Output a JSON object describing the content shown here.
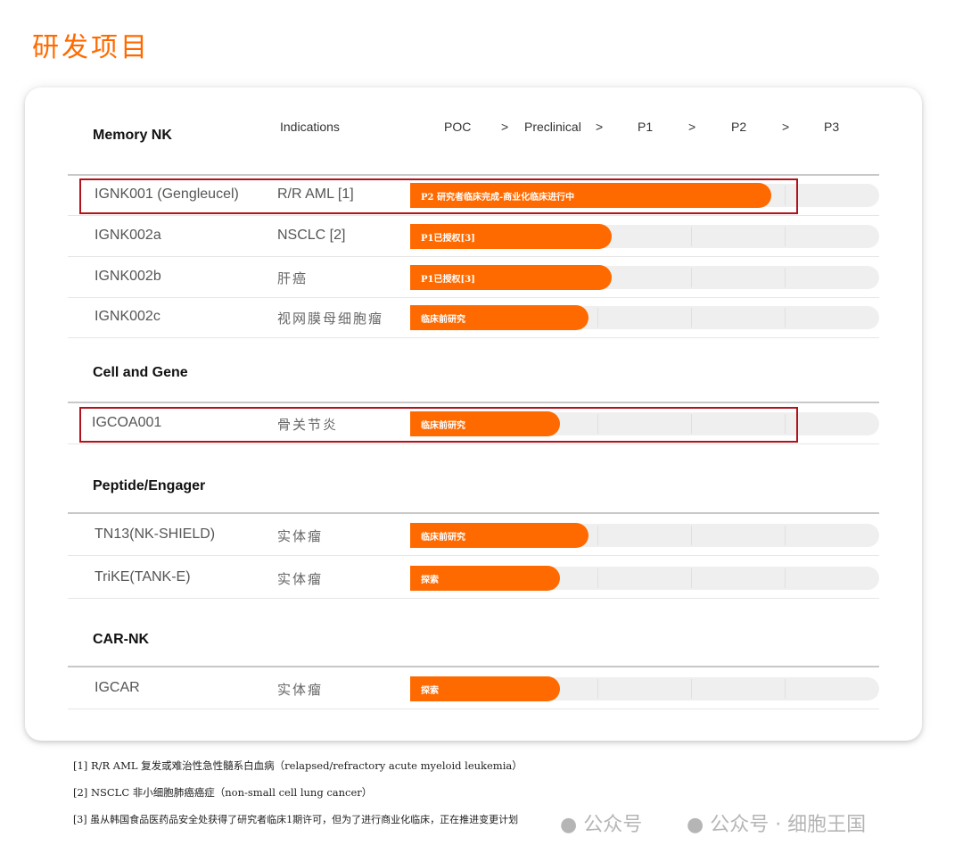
{
  "page_title": "研发项目",
  "header": {
    "section": "Memory NK",
    "indications": "Indications",
    "stages": [
      "POC",
      "Preclinical",
      "P1",
      "P2",
      "P3"
    ],
    "chevron": ">"
  },
  "colors": {
    "accent": "#ff6a00",
    "highlight": "#b0131b",
    "track": "#efefef"
  },
  "sections": [
    "Memory NK",
    "Cell and Gene",
    "Peptide/Engager",
    "CAR-NK"
  ],
  "chart_data": {
    "type": "bar",
    "orientation": "horizontal",
    "stage_axis": [
      "POC",
      "Preclinical",
      "P1",
      "P2",
      "P3"
    ],
    "rows": [
      {
        "section": "Memory NK",
        "name": "IGNK001 (Gengleucel)",
        "indication": "R/R AML [1]",
        "bar_label": "P2 研究者临床完成-商业化临床进行中",
        "progress": 0.77,
        "highlighted": true
      },
      {
        "section": "Memory NK",
        "name": "IGNK002a",
        "indication": "NSCLC [2]",
        "bar_label": "P1已授权[3]",
        "progress": 0.43,
        "highlighted": false
      },
      {
        "section": "Memory NK",
        "name": "IGNK002b",
        "indication": "肝癌",
        "bar_label": "P1已授权[3]",
        "progress": 0.43,
        "highlighted": false
      },
      {
        "section": "Memory NK",
        "name": "IGNK002c",
        "indication": "视网膜母细胞瘤",
        "bar_label": "临床前研究",
        "progress": 0.38,
        "highlighted": false
      },
      {
        "section": "Cell and Gene",
        "name": "IGCOA001",
        "indication": "骨关节炎",
        "bar_label": "临床前研究",
        "progress": 0.32,
        "highlighted": true
      },
      {
        "section": "Peptide/Engager",
        "name": "TN13(NK-SHIELD)",
        "indication": "实体瘤",
        "bar_label": "临床前研究",
        "progress": 0.38,
        "highlighted": false
      },
      {
        "section": "Peptide/Engager",
        "name": "TriKE(TANK-E)",
        "indication": "实体瘤",
        "bar_label": "探索",
        "progress": 0.32,
        "highlighted": false
      },
      {
        "section": "CAR-NK",
        "name": "IGCAR",
        "indication": "实体瘤",
        "bar_label": "探索",
        "progress": 0.32,
        "highlighted": false
      }
    ]
  },
  "footnotes": [
    "[1]  R/R AML 复发或难治性急性髓系白血病（relapsed/refractory acute myeloid leukemia）",
    "[2]  NSCLC 非小细胞肺癌癌症（non-small cell lung cancer）",
    "[3]  虽从韩国食品医药品安全处获得了研究者临床1期许可，但为了进行商业化临床，正在推进变更计划"
  ],
  "watermark": {
    "text1": "公众号",
    "text2": "公众号 · 细胞王国"
  }
}
